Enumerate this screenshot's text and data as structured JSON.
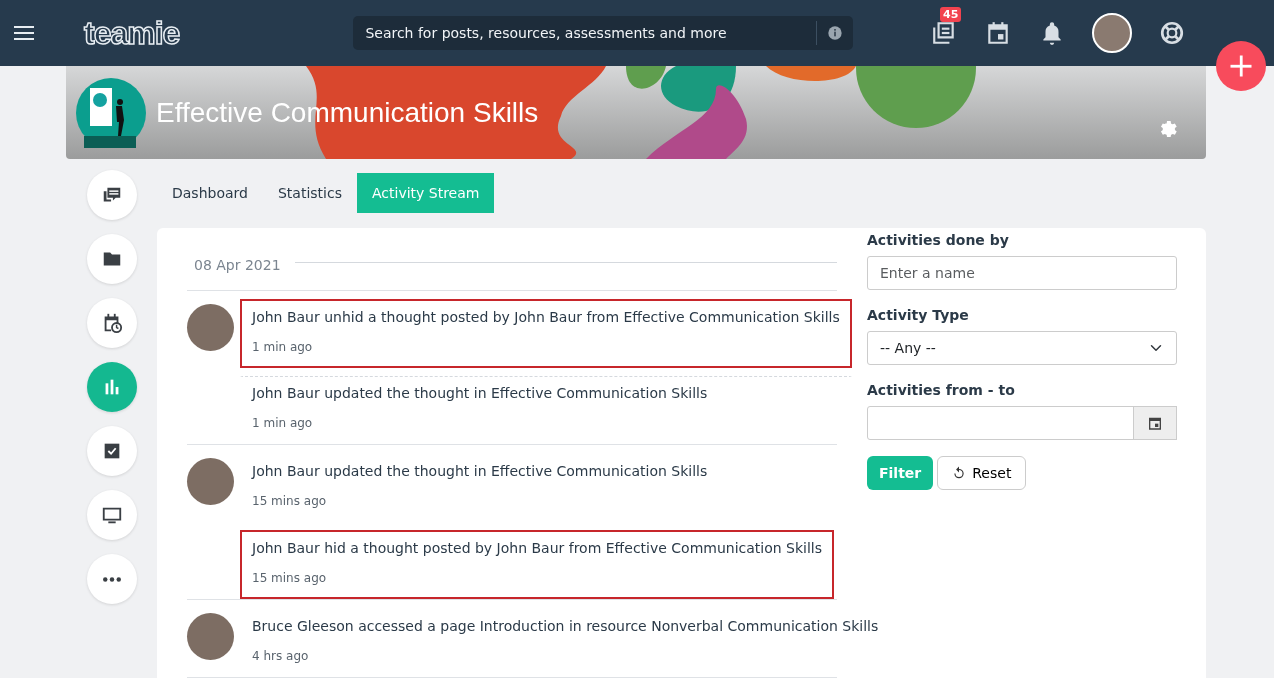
{
  "navbar": {
    "logo": "teamie",
    "search": {
      "placeholder": "Search for posts, resources, assessments and more"
    },
    "newsfeed_badge": "45"
  },
  "course": {
    "title": "Effective Communication Skills"
  },
  "sidebar": {
    "items": [
      {
        "kind": "discussion",
        "selected": false
      },
      {
        "kind": "folder",
        "selected": false
      },
      {
        "kind": "schedule",
        "selected": false
      },
      {
        "kind": "stats",
        "selected": true
      },
      {
        "kind": "tasks",
        "selected": false
      },
      {
        "kind": "screen",
        "selected": false
      },
      {
        "kind": "more",
        "selected": false
      }
    ]
  },
  "tabs": [
    {
      "label": "Dashboard",
      "selected": false
    },
    {
      "label": "Statistics",
      "selected": false
    },
    {
      "label": "Activity Stream",
      "selected": true
    }
  ],
  "stream": {
    "date": "08 Apr 2021",
    "groups": [
      {
        "entries": [
          {
            "text": "John Baur unhid a thought posted by John Baur from Effective Communication Skills",
            "time": "1 min ago",
            "highlighted": true
          },
          {
            "text": "John Baur updated the thought in Effective Communication Skills",
            "time": "1 min ago",
            "highlighted": false
          }
        ]
      },
      {
        "entries": [
          {
            "text": "John Baur updated the thought in Effective Communication Skills",
            "time": "15 mins ago",
            "highlighted": false
          },
          {
            "text": "John Baur hid a thought posted by John Baur from Effective Communication Skills",
            "time": "15 mins ago",
            "highlighted": true
          }
        ]
      },
      {
        "entries": [
          {
            "text": "Bruce Gleeson accessed a page Introduction in resource Nonverbal Communication Skills",
            "time": "4 hrs ago",
            "highlighted": false
          }
        ]
      }
    ]
  },
  "filters": {
    "done_by": {
      "label": "Activities done by",
      "placeholder": "Enter a name"
    },
    "type": {
      "label": "Activity Type",
      "value": "-- Any --"
    },
    "range": {
      "label": "Activities from - to"
    },
    "buttons": [
      {
        "kind": "primary",
        "label": "Filter"
      },
      {
        "kind": "reset",
        "label": "Reset"
      }
    ]
  }
}
